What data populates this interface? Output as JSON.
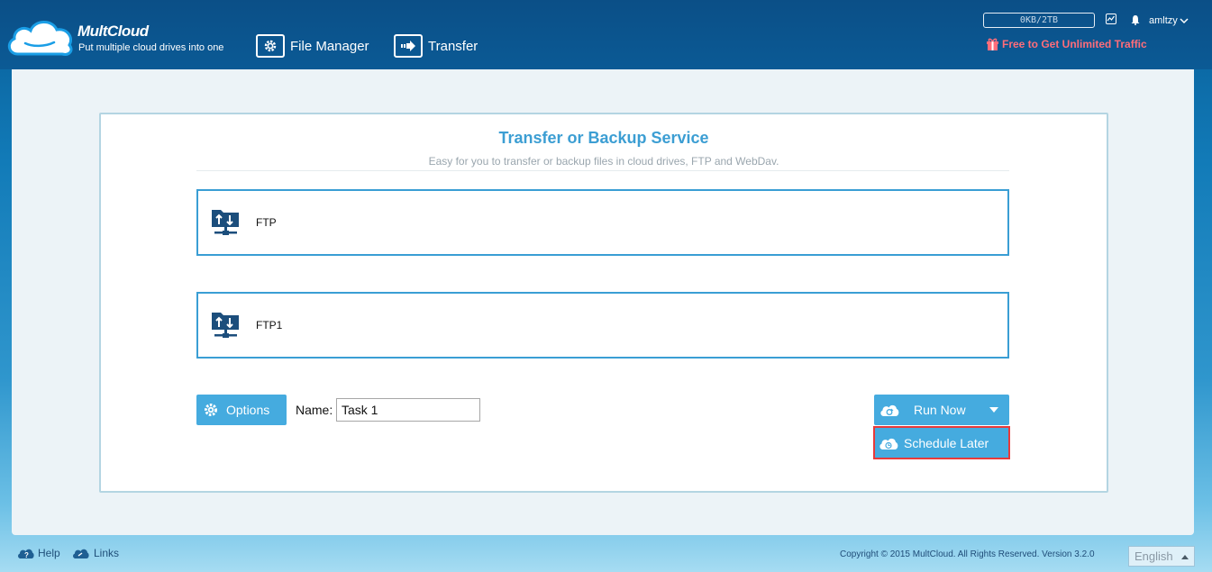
{
  "header": {
    "logo_name": "MultCloud",
    "logo_tagline": "Put multiple cloud drives into one",
    "nav": [
      {
        "label": "File Manager",
        "icon": "gear-icon"
      },
      {
        "label": "Transfer",
        "icon": "arrow-right-icon"
      }
    ],
    "traffic": "0KB/2TB",
    "username": "amltzy",
    "promo": "Free to Get Unlimited Traffic"
  },
  "card": {
    "title": "Transfer or Backup Service",
    "subtitle": "Easy for you to transfer or backup files in cloud drives, FTP and WebDav.",
    "source": {
      "label": "FTP",
      "icon": "ftp-folder-icon"
    },
    "target": {
      "label": "FTP1",
      "icon": "ftp-folder-icon"
    },
    "options_label": "Options",
    "name_label": "Name:",
    "task_name": "Task 1",
    "run_now_label": "Run Now",
    "schedule_later_label": "Schedule Later"
  },
  "footer": {
    "help": "Help",
    "links": "Links",
    "copyright": "Copyright © 2015 MultCloud. All Rights Reserved. Version 3.2.0",
    "language": "English"
  },
  "colors": {
    "accent": "#45abdf",
    "header_bg": "#0b4f87",
    "highlight_border": "#e83a3a",
    "promo": "#ff6d7a",
    "title": "#3c9ed3"
  }
}
